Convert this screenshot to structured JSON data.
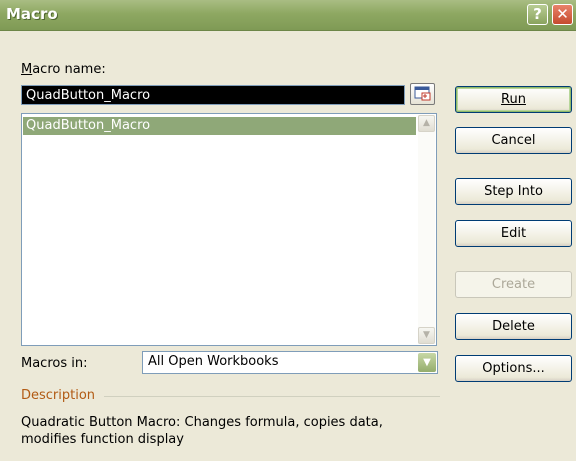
{
  "window": {
    "title": "Macro"
  },
  "labels": {
    "macro_name": "Macro name:",
    "macros_in": "Macros in:",
    "description": "Description"
  },
  "macro_name_value": "QuadButton_Macro",
  "macro_list": [
    "QuadButton_Macro"
  ],
  "macros_in_value": "All Open Workbooks",
  "description_text": "Quadratic Button Macro:  Changes formula, copies data, modifies function display",
  "buttons": {
    "run": "Run",
    "cancel": "Cancel",
    "step_into": "Step Into",
    "edit": "Edit",
    "create": "Create",
    "delete": "Delete",
    "options": "Options..."
  },
  "icons": {
    "help": "help-icon",
    "close": "close-icon",
    "collapse": "collapse-dialog-icon"
  },
  "colors": {
    "titlebar": "#8ea862",
    "selection": "#8fa878",
    "description_label": "#b25b14"
  }
}
